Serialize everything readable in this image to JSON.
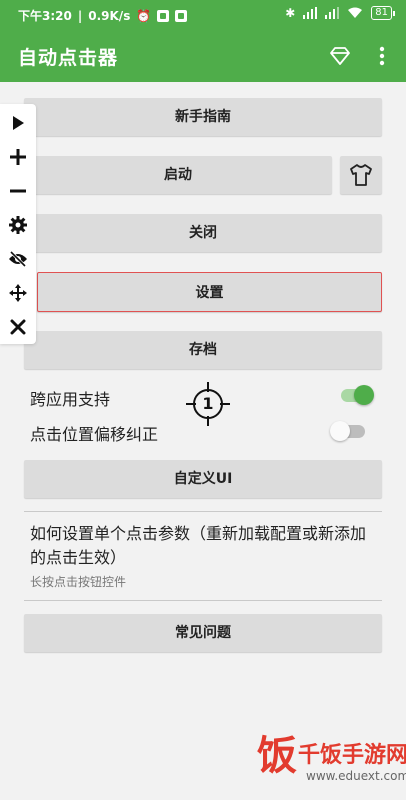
{
  "status_bar": {
    "time": "下午3:20",
    "network_speed": "0.9K/s",
    "battery": "81"
  },
  "app_bar": {
    "title": "自动点击器",
    "diamond_icon": "diamond-icon",
    "more_icon": "more-vert-icon"
  },
  "float_toolbar": {
    "icons": [
      "play-icon",
      "plus-icon",
      "minus-icon",
      "gear-icon",
      "eye-off-icon",
      "move-icon",
      "close-icon"
    ]
  },
  "buttons": {
    "guide": "新手指南",
    "start": "启动",
    "close": "关闭",
    "settings": "设置",
    "save": "存档",
    "custom_ui": "自定义UI",
    "faq": "常见问题"
  },
  "toggles": {
    "cross_app": {
      "label": "跨应用支持",
      "on": true
    },
    "offset_fix": {
      "label": "点击位置偏移纠正",
      "on": false
    }
  },
  "target_marker": {
    "number": "1"
  },
  "help": {
    "title": "如何设置单个点击参数（重新加载配置或新添加的点击生效）",
    "subtitle": "长按点击按钮控件"
  },
  "watermark": {
    "logo_char": "饭",
    "name": "千饭手游网",
    "url": "www.eduext.com"
  },
  "colors": {
    "primary": "#4fad4a",
    "button_bg": "#dcdcdc",
    "highlight_border": "#e05252",
    "watermark_red": "#e23b2e"
  }
}
